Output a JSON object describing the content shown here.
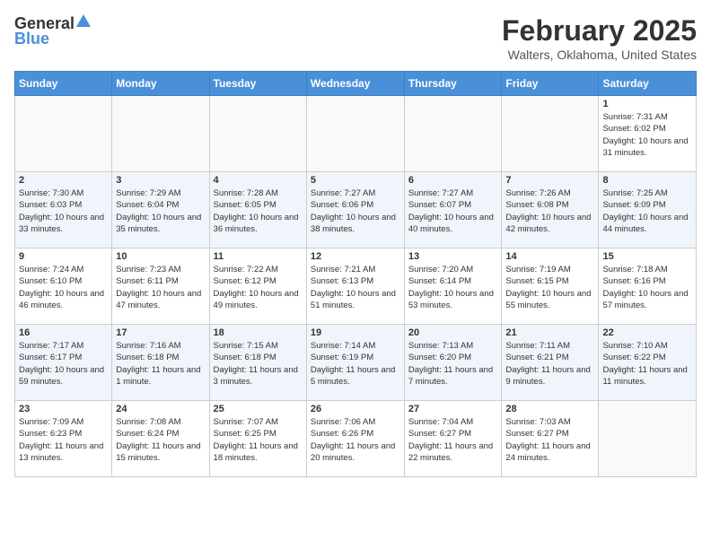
{
  "header": {
    "logo_general": "General",
    "logo_blue": "Blue",
    "title": "February 2025",
    "subtitle": "Walters, Oklahoma, United States"
  },
  "days_of_week": [
    "Sunday",
    "Monday",
    "Tuesday",
    "Wednesday",
    "Thursday",
    "Friday",
    "Saturday"
  ],
  "weeks": [
    [
      {
        "day": null
      },
      {
        "day": null
      },
      {
        "day": null
      },
      {
        "day": null
      },
      {
        "day": null
      },
      {
        "day": null
      },
      {
        "day": 1,
        "sunrise": "7:31 AM",
        "sunset": "6:02 PM",
        "daylight": "10 hours and 31 minutes."
      }
    ],
    [
      {
        "day": 2,
        "sunrise": "7:30 AM",
        "sunset": "6:03 PM",
        "daylight": "10 hours and 33 minutes."
      },
      {
        "day": 3,
        "sunrise": "7:29 AM",
        "sunset": "6:04 PM",
        "daylight": "10 hours and 35 minutes."
      },
      {
        "day": 4,
        "sunrise": "7:28 AM",
        "sunset": "6:05 PM",
        "daylight": "10 hours and 36 minutes."
      },
      {
        "day": 5,
        "sunrise": "7:27 AM",
        "sunset": "6:06 PM",
        "daylight": "10 hours and 38 minutes."
      },
      {
        "day": 6,
        "sunrise": "7:27 AM",
        "sunset": "6:07 PM",
        "daylight": "10 hours and 40 minutes."
      },
      {
        "day": 7,
        "sunrise": "7:26 AM",
        "sunset": "6:08 PM",
        "daylight": "10 hours and 42 minutes."
      },
      {
        "day": 8,
        "sunrise": "7:25 AM",
        "sunset": "6:09 PM",
        "daylight": "10 hours and 44 minutes."
      }
    ],
    [
      {
        "day": 9,
        "sunrise": "7:24 AM",
        "sunset": "6:10 PM",
        "daylight": "10 hours and 46 minutes."
      },
      {
        "day": 10,
        "sunrise": "7:23 AM",
        "sunset": "6:11 PM",
        "daylight": "10 hours and 47 minutes."
      },
      {
        "day": 11,
        "sunrise": "7:22 AM",
        "sunset": "6:12 PM",
        "daylight": "10 hours and 49 minutes."
      },
      {
        "day": 12,
        "sunrise": "7:21 AM",
        "sunset": "6:13 PM",
        "daylight": "10 hours and 51 minutes."
      },
      {
        "day": 13,
        "sunrise": "7:20 AM",
        "sunset": "6:14 PM",
        "daylight": "10 hours and 53 minutes."
      },
      {
        "day": 14,
        "sunrise": "7:19 AM",
        "sunset": "6:15 PM",
        "daylight": "10 hours and 55 minutes."
      },
      {
        "day": 15,
        "sunrise": "7:18 AM",
        "sunset": "6:16 PM",
        "daylight": "10 hours and 57 minutes."
      }
    ],
    [
      {
        "day": 16,
        "sunrise": "7:17 AM",
        "sunset": "6:17 PM",
        "daylight": "10 hours and 59 minutes."
      },
      {
        "day": 17,
        "sunrise": "7:16 AM",
        "sunset": "6:18 PM",
        "daylight": "11 hours and 1 minute."
      },
      {
        "day": 18,
        "sunrise": "7:15 AM",
        "sunset": "6:18 PM",
        "daylight": "11 hours and 3 minutes."
      },
      {
        "day": 19,
        "sunrise": "7:14 AM",
        "sunset": "6:19 PM",
        "daylight": "11 hours and 5 minutes."
      },
      {
        "day": 20,
        "sunrise": "7:13 AM",
        "sunset": "6:20 PM",
        "daylight": "11 hours and 7 minutes."
      },
      {
        "day": 21,
        "sunrise": "7:11 AM",
        "sunset": "6:21 PM",
        "daylight": "11 hours and 9 minutes."
      },
      {
        "day": 22,
        "sunrise": "7:10 AM",
        "sunset": "6:22 PM",
        "daylight": "11 hours and 11 minutes."
      }
    ],
    [
      {
        "day": 23,
        "sunrise": "7:09 AM",
        "sunset": "6:23 PM",
        "daylight": "11 hours and 13 minutes."
      },
      {
        "day": 24,
        "sunrise": "7:08 AM",
        "sunset": "6:24 PM",
        "daylight": "11 hours and 15 minutes."
      },
      {
        "day": 25,
        "sunrise": "7:07 AM",
        "sunset": "6:25 PM",
        "daylight": "11 hours and 18 minutes."
      },
      {
        "day": 26,
        "sunrise": "7:06 AM",
        "sunset": "6:26 PM",
        "daylight": "11 hours and 20 minutes."
      },
      {
        "day": 27,
        "sunrise": "7:04 AM",
        "sunset": "6:27 PM",
        "daylight": "11 hours and 22 minutes."
      },
      {
        "day": 28,
        "sunrise": "7:03 AM",
        "sunset": "6:27 PM",
        "daylight": "11 hours and 24 minutes."
      },
      {
        "day": null
      }
    ]
  ]
}
